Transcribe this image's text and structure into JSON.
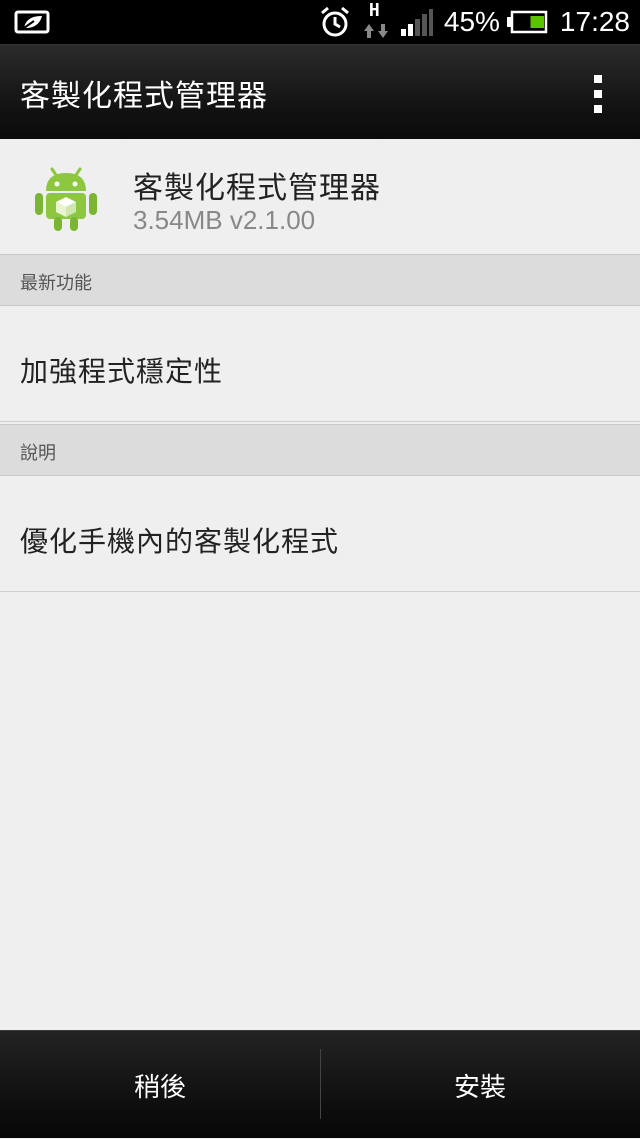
{
  "status_bar": {
    "battery_percent": "45%",
    "time": "17:28",
    "network_type": "H",
    "icons": [
      "sense-leaf-icon",
      "alarm-clock-icon",
      "network-data-icon",
      "signal-strength-icon",
      "battery-icon"
    ],
    "battery_level": 0.45,
    "battery_color": "#5bc400"
  },
  "action_bar": {
    "title": "客製化程式管理器",
    "menu_icon": "overflow-menu-icon"
  },
  "app": {
    "name": "客製化程式管理器",
    "meta": "3.54MB v2.1.00",
    "icon": "android-robot-icon",
    "icon_color": "#8dc63f"
  },
  "sections": {
    "whats_new": {
      "header": "最新功能",
      "body": "加強程式穩定性"
    },
    "description": {
      "header": "說明",
      "body": "優化手機內的客製化程式"
    }
  },
  "buttons": {
    "later": "稍後",
    "install": "安裝"
  }
}
